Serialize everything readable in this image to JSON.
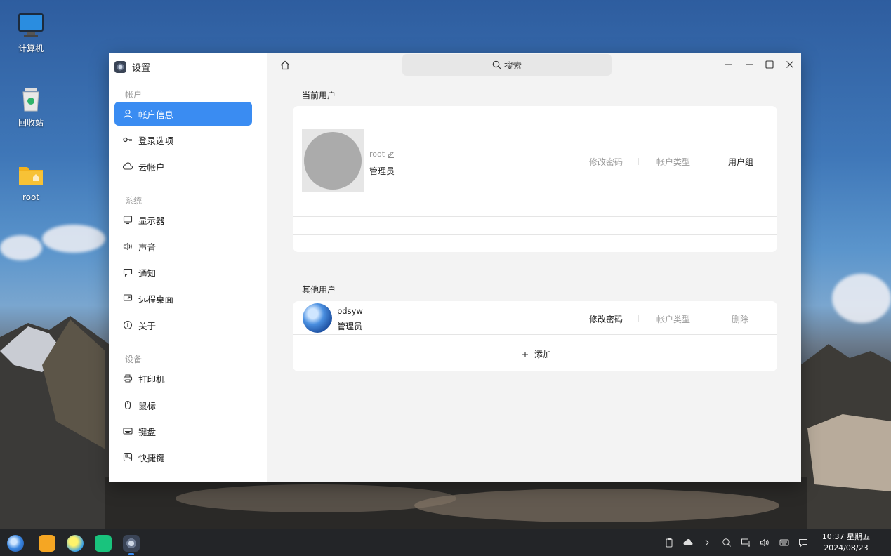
{
  "desktop": {
    "icons": [
      {
        "label": "计算机"
      },
      {
        "label": "回收站"
      },
      {
        "label": "root"
      }
    ]
  },
  "window": {
    "app_title": "设置",
    "search_placeholder": "搜索",
    "sidebar": {
      "sections": [
        {
          "title": "帐户",
          "items": [
            "帐户信息",
            "登录选项",
            "云帐户"
          ]
        },
        {
          "title": "系统",
          "items": [
            "显示器",
            "声音",
            "通知",
            "远程桌面",
            "关于"
          ]
        },
        {
          "title": "设备",
          "items": [
            "打印机",
            "鼠标",
            "键盘",
            "快捷键"
          ]
        }
      ],
      "active_item": "帐户信息"
    },
    "current_user": {
      "heading": "当前用户",
      "username": "root",
      "role": "管理员",
      "actions": {
        "change_password": "修改密码",
        "account_type": "帐户类型",
        "user_group": "用户组"
      }
    },
    "other_users": {
      "heading": "其他用户",
      "users": [
        {
          "username": "pdsyw",
          "role": "管理员",
          "change_password": "修改密码",
          "account_type": "帐户类型",
          "delete": "删除"
        }
      ],
      "add_label": "添加"
    }
  },
  "taskbar": {
    "time": "10:37 星期五",
    "date": "2024/08/23"
  },
  "colors": {
    "accent": "#3a8cf2"
  }
}
